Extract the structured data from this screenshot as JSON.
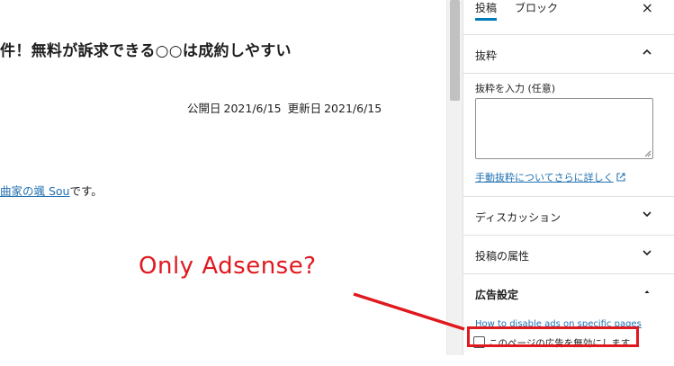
{
  "editor": {
    "title": "件！無料が訴求できる○○は成約しやすい",
    "published_label": "公開日",
    "published_date": "2021/6/15",
    "updated_label": "更新日",
    "updated_date": "2021/6/15",
    "paragraph_link": "曲家の颯 Sou",
    "paragraph_suffix": "です。"
  },
  "sidebar": {
    "tabs": [
      "投稿",
      "ブロック"
    ],
    "close_glyph": "×",
    "panels": [
      {
        "title": "抜粋",
        "expanded": true
      },
      {
        "title": "ディスカッション",
        "expanded": false
      },
      {
        "title": "投稿の属性",
        "expanded": false
      },
      {
        "title": "広告設定",
        "expanded": true
      }
    ],
    "excerpt": {
      "label": "抜粋を入力 (任意)",
      "value": "",
      "link": "手動抜粋についてさらに詳しく"
    },
    "ad_settings": {
      "link": "How to disable ads on specific pages",
      "checkbox_label": "このページの広告を無効にします。",
      "checked": false
    }
  },
  "annotation": {
    "text": "Only Adsense?",
    "color": "#e0191f"
  },
  "colors": {
    "link": "#2271b1",
    "accent": "#007cba",
    "annotation": "#e0191f"
  }
}
